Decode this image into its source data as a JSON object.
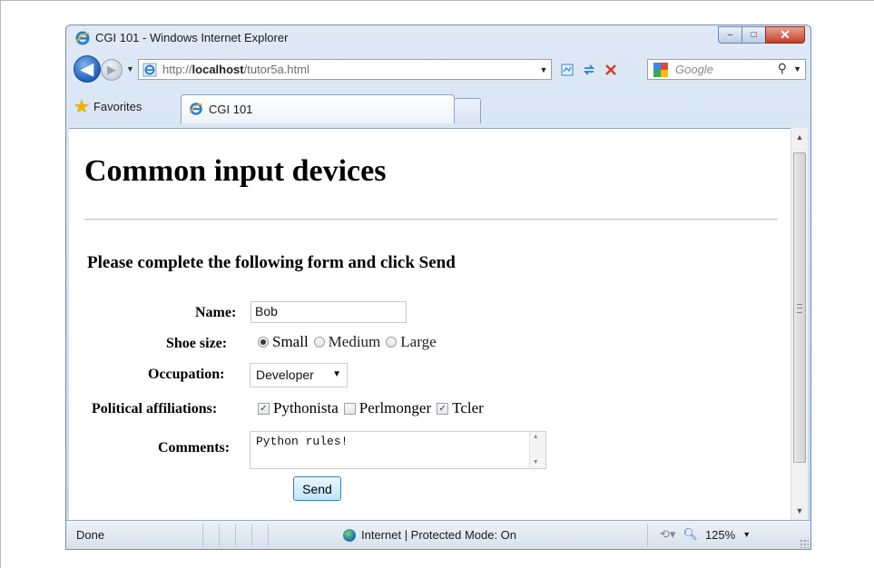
{
  "window": {
    "title": "CGI 101 - Windows Internet Explorer",
    "minimize_glyph": "–",
    "maximize_glyph": "□",
    "close_glyph": "✕"
  },
  "navbar": {
    "back_glyph": "◀",
    "forward_glyph": "▶",
    "address_prefix": "http://",
    "address_host": "localhost",
    "address_path": "/tutor5a.html",
    "search_placeholder": "Google",
    "search_glyph": "⚲",
    "dropdown_glyph": "▼"
  },
  "tabs": {
    "favorites_label": "Favorites",
    "active_tab_label": "CGI 101"
  },
  "page": {
    "heading": "Common input devices",
    "subheading": "Please complete the following form and click Send",
    "labels": {
      "name": "Name:",
      "shoe_size": "Shoe size:",
      "occupation": "Occupation:",
      "political": "Political affiliations:",
      "comments": "Comments:"
    },
    "name_value": "Bob",
    "shoe_options": [
      "Small",
      "Medium",
      "Large"
    ],
    "shoe_selected": "Small",
    "occupation_value": "Developer",
    "affiliations": [
      {
        "label": "Pythonista",
        "checked": true
      },
      {
        "label": "Perlmonger",
        "checked": false
      },
      {
        "label": "Tcler",
        "checked": true
      }
    ],
    "comments_value": "Python rules!",
    "send_label": "Send"
  },
  "statusbar": {
    "status": "Done",
    "zone": "Internet | Protected Mode: On",
    "zoom": "125%"
  },
  "colors": {
    "title_text": "#1b1b1b",
    "send_border": "#3c7fb1",
    "close_button": "#c2402a",
    "checkmark": "#1b3c7a"
  }
}
